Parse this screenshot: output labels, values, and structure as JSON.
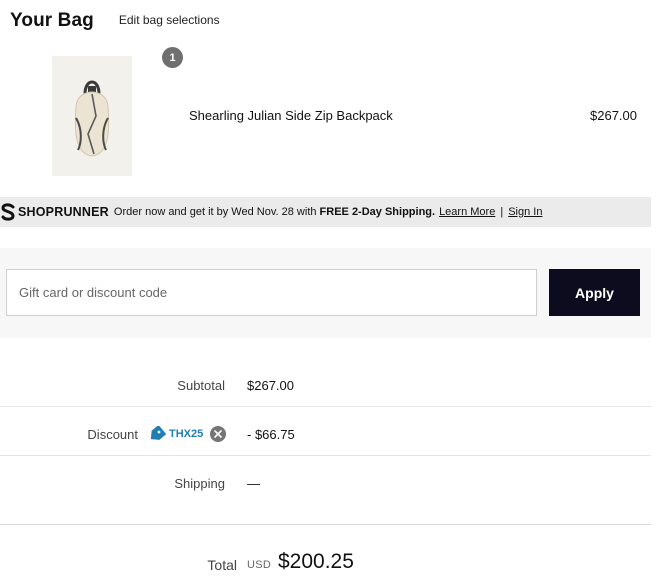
{
  "bag": {
    "title": "Your Bag",
    "edit_link": "Edit bag selections"
  },
  "item": {
    "quantity": "1",
    "name": "Shearling Julian Side Zip Backpack",
    "price": "$267.00",
    "image_icon": "backpack-image"
  },
  "shoprunner": {
    "brand": "SHOPRUNNER",
    "message_start": "Order now and get it by Wed Nov. 28 with ",
    "message_bold": "FREE 2-Day Shipping.",
    "learn_more": "Learn More",
    "separator": "|",
    "sign_in": "Sign In"
  },
  "promo": {
    "placeholder": "Gift card or discount code",
    "value": "",
    "apply_label": "Apply"
  },
  "summary": {
    "subtotal_label": "Subtotal",
    "subtotal_value": "$267.00",
    "discount_label": "Discount",
    "discount_code": "THX25",
    "discount_value": "- $66.75",
    "shipping_label": "Shipping",
    "shipping_value": "—",
    "total_label": "Total",
    "total_currency": "USD",
    "total_value": "$200.25"
  },
  "colors": {
    "apply_button": "#0d0b1e",
    "coupon_code": "#1f7fb5",
    "shoprunner_bar": "#ebebeb",
    "badge": "#6f6f6f"
  }
}
